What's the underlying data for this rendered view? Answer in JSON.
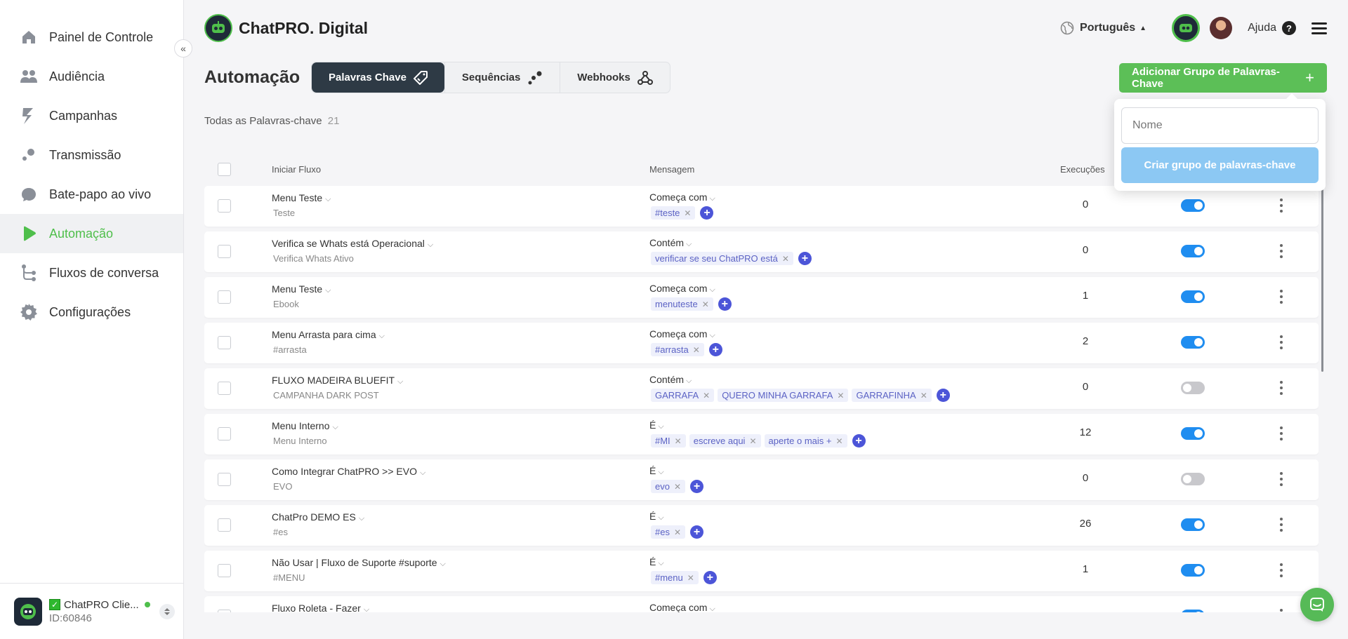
{
  "sidebar": {
    "items": [
      {
        "label": "Painel de Controle",
        "icon": "home-icon"
      },
      {
        "label": "Audiência",
        "icon": "users-icon"
      },
      {
        "label": "Campanhas",
        "icon": "campaign-icon"
      },
      {
        "label": "Transmissão",
        "icon": "broadcast-icon"
      },
      {
        "label": "Bate-papo ao vivo",
        "icon": "chat-icon"
      },
      {
        "label": "Automação",
        "icon": "play-icon",
        "active": true
      },
      {
        "label": "Fluxos de conversa",
        "icon": "flow-icon"
      },
      {
        "label": "Configurações",
        "icon": "gear-icon"
      }
    ],
    "collapse_icon": "«",
    "account": {
      "name": "ChatPRO Clie...",
      "id": "ID:60846",
      "check": "✓"
    }
  },
  "header": {
    "brand": "ChatPRO. Digital",
    "language": "Português",
    "help": "Ajuda",
    "help_glyph": "?"
  },
  "page": {
    "title": "Automação",
    "tabs": [
      {
        "label": "Palavras Chave",
        "icon": "tag-icon",
        "active": true
      },
      {
        "label": "Sequências",
        "icon": "sequence-icon"
      },
      {
        "label": "Webhooks",
        "icon": "webhook-icon"
      }
    ],
    "add_button": "Adicionar Grupo de Palavras-Chave",
    "add_plus": "+",
    "all_keywords_label": "Todas as Palavras-chave",
    "all_keywords_count": "21"
  },
  "table": {
    "headers": {
      "flow": "Iniciar Fluxo",
      "message": "Mensagem",
      "executions": "Execuções"
    },
    "rows": [
      {
        "flow": "Menu Teste",
        "sub": "Teste",
        "match": "Começa com",
        "chips": [
          "#teste"
        ],
        "exec": "0",
        "enabled": true
      },
      {
        "flow": "Verifica se Whats está Operacional",
        "sub": "Verifica Whats Ativo",
        "match": "Contém",
        "chips": [
          "verificar se seu ChatPRO está"
        ],
        "exec": "0",
        "enabled": true
      },
      {
        "flow": "Menu Teste",
        "sub": "Ebook",
        "match": "Começa com",
        "chips": [
          "menuteste"
        ],
        "exec": "1",
        "enabled": true
      },
      {
        "flow": "Menu Arrasta para cima",
        "sub": "#arrasta",
        "match": "Começa com",
        "chips": [
          "#arrasta"
        ],
        "exec": "2",
        "enabled": true
      },
      {
        "flow": "FLUXO MADEIRA BLUEFIT",
        "sub": "CAMPANHA DARK POST",
        "match": "Contém",
        "chips": [
          "GARRAFA",
          "QUERO MINHA GARRAFA",
          "GARRAFINHA"
        ],
        "exec": "0",
        "enabled": false
      },
      {
        "flow": "Menu Interno",
        "sub": "Menu Interno",
        "match": "É",
        "chips": [
          "#MI",
          "escreve aqui",
          "aperte o mais +"
        ],
        "exec": "12",
        "enabled": true
      },
      {
        "flow": "Como Integrar ChatPRO >> EVO",
        "sub": "EVO",
        "match": "É",
        "chips": [
          "evo"
        ],
        "exec": "0",
        "enabled": false
      },
      {
        "flow": "ChatPro DEMO ES",
        "sub": "#es",
        "match": "É",
        "chips": [
          "#es"
        ],
        "exec": "26",
        "enabled": true
      },
      {
        "flow": "Não Usar | Fluxo de Suporte #suporte",
        "sub": "#MENU",
        "match": "É",
        "chips": [
          "#menu"
        ],
        "exec": "1",
        "enabled": true
      },
      {
        "flow": "Fluxo Roleta - Fazer",
        "sub": "",
        "match": "Começa com",
        "chips": [],
        "exec": "",
        "enabled": true
      }
    ]
  },
  "popover": {
    "input_placeholder": "Nome",
    "create_button": "Criar grupo de palavras-chave"
  },
  "colors": {
    "accent_green": "#5cbf57",
    "toggle_on": "#1f8df0",
    "chip_add": "#4c55d8",
    "tab_active": "#2e3a45"
  }
}
